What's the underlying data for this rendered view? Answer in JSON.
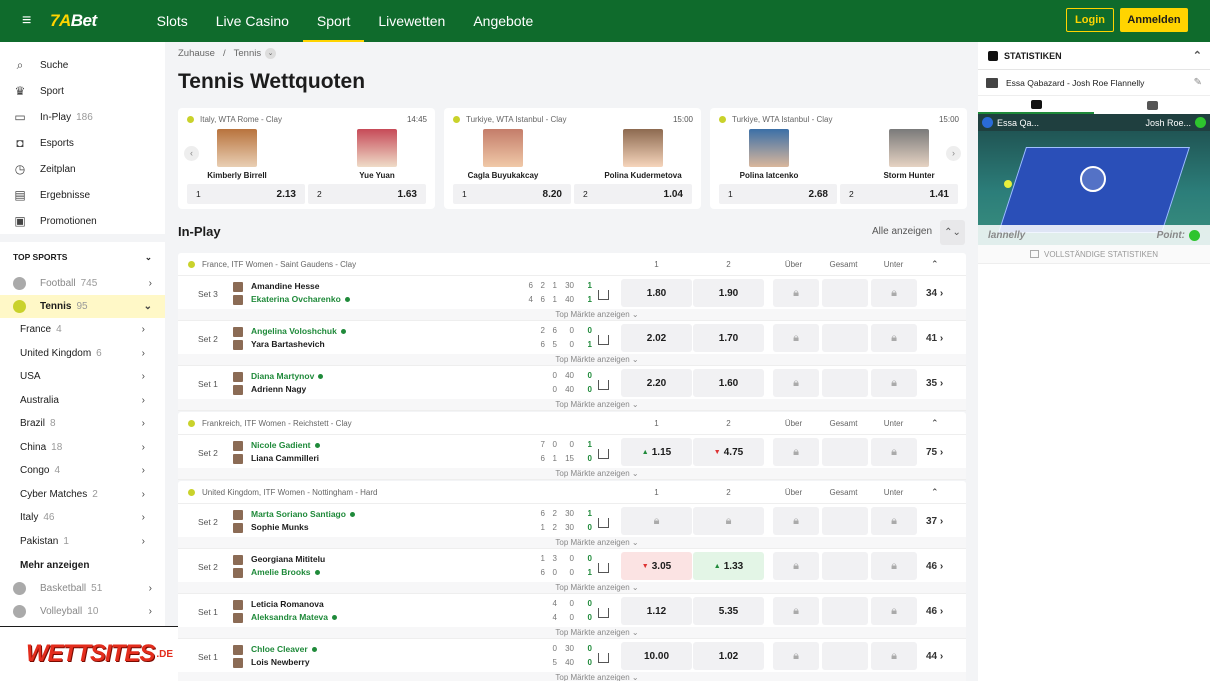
{
  "header": {
    "brand": "7A",
    "brand2": "Bet",
    "nav": [
      "Slots",
      "Live Casino",
      "Sport",
      "Livewetten",
      "Angebote"
    ],
    "active_nav": "Sport",
    "login": "Login",
    "register": "Anmelden"
  },
  "sidebar": {
    "items": [
      {
        "label": "Suche",
        "icon": "search-icon"
      },
      {
        "label": "Sport",
        "icon": "trophy-icon"
      },
      {
        "label": "In-Play",
        "count": "186",
        "icon": "live-icon"
      },
      {
        "label": "Esports",
        "icon": "gamepad-icon"
      },
      {
        "label": "Zeitplan",
        "icon": "clock-icon"
      },
      {
        "label": "Ergebnisse",
        "icon": "clipboard-icon"
      },
      {
        "label": "Promotionen",
        "icon": "gift-icon"
      }
    ],
    "top_sports": "TOP SPORTS",
    "sports_top": [
      {
        "label": "Football",
        "count": "745"
      },
      {
        "label": "Tennis",
        "count": "95"
      }
    ],
    "countries": [
      {
        "label": "France",
        "count": "4"
      },
      {
        "label": "United Kingdom",
        "count": "6"
      },
      {
        "label": "USA",
        "count": ""
      },
      {
        "label": "Australia",
        "count": ""
      },
      {
        "label": "Brazil",
        "count": "8"
      },
      {
        "label": "China",
        "count": "18"
      },
      {
        "label": "Congo",
        "count": "4"
      },
      {
        "label": "Cyber Matches",
        "count": "2"
      },
      {
        "label": "Italy",
        "count": "46"
      },
      {
        "label": "Pakistan",
        "count": "1"
      }
    ],
    "more": "Mehr anzeigen",
    "sports_bottom": [
      {
        "label": "Basketball",
        "count": "51"
      },
      {
        "label": "Volleyball",
        "count": "10"
      }
    ]
  },
  "watermark": {
    "text": "WETTSITES",
    "suffix": ".DE"
  },
  "breadcrumb": {
    "home": "Zuhause",
    "current": "Tennis"
  },
  "page_title": "Tennis Wettquoten",
  "cards": [
    {
      "league": "Italy, WTA Rome - Clay",
      "time": "14:45",
      "p1": "Kimberly Birrell",
      "p2": "Yue Yuan",
      "l1": "1",
      "o1": "2.13",
      "l2": "2",
      "o2": "1.63"
    },
    {
      "league": "Turkiye, WTA Istanbul - Clay",
      "time": "15:00",
      "p1": "Cagla Buyukakcay",
      "p2": "Polina Kudermetova",
      "l1": "1",
      "o1": "8.20",
      "l2": "2",
      "o2": "1.04"
    },
    {
      "league": "Turkiye, WTA Istanbul - Clay",
      "time": "15:00",
      "p1": "Polina Iatcenko",
      "p2": "Storm Hunter",
      "l1": "1",
      "o1": "2.68",
      "l2": "2",
      "o2": "1.41"
    }
  ],
  "inplay": {
    "title": "In-Play",
    "show_all": "Alle anzeigen"
  },
  "columns": [
    "1",
    "2",
    "Über",
    "Gesamt",
    "Unter"
  ],
  "top_markets": "Top Märkte anzeigen ⌄",
  "groups": [
    {
      "league": "France, ITF Women - Saint Gaudens - Clay",
      "matches": [
        {
          "set": "Set 3",
          "p1": "Amandine Hesse",
          "p2": "Ekaterina Ovcharenko",
          "serve": 2,
          "s1": [
            "6",
            "2",
            "1",
            "30",
            "1"
          ],
          "s2": [
            "4",
            "6",
            "1",
            "40",
            "1"
          ],
          "o1": "1.80",
          "o2": "1.90",
          "more": "34 ›"
        },
        {
          "set": "Set 2",
          "p1": "Angelina Voloshchuk",
          "p2": "Yara Bartashevich",
          "serve": 1,
          "s1": [
            "",
            "2",
            "6",
            "0",
            "0"
          ],
          "s2": [
            "",
            "6",
            "5",
            "0",
            "1"
          ],
          "o1": "2.02",
          "o2": "1.70",
          "more": "41 ›"
        },
        {
          "set": "Set 1",
          "p1": "Diana Martynov",
          "p2": "Adrienn Nagy",
          "serve": 1,
          "s1": [
            "",
            "",
            "0",
            "40",
            "0"
          ],
          "s2": [
            "",
            "",
            "0",
            "40",
            "0"
          ],
          "o1": "2.20",
          "o2": "1.60",
          "more": "35 ›"
        }
      ]
    },
    {
      "league": "Frankreich, ITF Women - Reichstett - Clay",
      "matches": [
        {
          "set": "Set 2",
          "p1": "Nicole Gadient",
          "p2": "Liana Cammilleri",
          "serve": 1,
          "s1": [
            "",
            "7",
            "0",
            "0",
            "1"
          ],
          "s2": [
            "",
            "6",
            "1",
            "15",
            "0"
          ],
          "o1": "1.15",
          "o2": "4.75",
          "a1": "up",
          "a2": "down",
          "more": "75 ›"
        }
      ]
    },
    {
      "league": "United Kingdom, ITF Women - Nottingham - Hard",
      "matches": [
        {
          "set": "Set 2",
          "p1": "Marta Soriano Santiago",
          "p2": "Sophie Munks",
          "serve": 1,
          "s1": [
            "",
            "6",
            "2",
            "30",
            "1"
          ],
          "s2": [
            "",
            "1",
            "2",
            "30",
            "0"
          ],
          "o1": "",
          "o2": "",
          "more": "37 ›"
        },
        {
          "set": "Set 2",
          "p1": "Georgiana Mititelu",
          "p2": "Amelie Brooks",
          "serve": 2,
          "s1": [
            "",
            "1",
            "3",
            "0",
            "0"
          ],
          "s2": [
            "",
            "6",
            "0",
            "0",
            "1"
          ],
          "o1": "3.05",
          "o2": "1.33",
          "a1": "down",
          "a2": "up",
          "more": "46 ›"
        },
        {
          "set": "Set 1",
          "p1": "Leticia Romanova",
          "p2": "Aleksandra Mateva",
          "serve": 2,
          "s1": [
            "",
            "",
            "4",
            "0",
            "0"
          ],
          "s2": [
            "",
            "",
            "4",
            "0",
            "0"
          ],
          "o1": "1.12",
          "o2": "5.35",
          "more": "46 ›"
        },
        {
          "set": "Set 1",
          "p1": "Chloe Cleaver",
          "p2": "Lois Newberry",
          "serve": 1,
          "s1": [
            "",
            "",
            "0",
            "30",
            "0"
          ],
          "s2": [
            "",
            "",
            "5",
            "40",
            "0"
          ],
          "o1": "10.00",
          "o2": "1.02",
          "more": "44 ›"
        }
      ]
    }
  ],
  "stats": {
    "title": "STATISTIKEN",
    "match": "Essa Qabazard - Josh Roe Flannelly",
    "left_player": "Essa Qa...",
    "right_player": "Josh Roe...",
    "foot_left": "lannelly",
    "foot_right": "Point:",
    "full": "VOLLSTÄNDIGE STATISTIKEN"
  }
}
